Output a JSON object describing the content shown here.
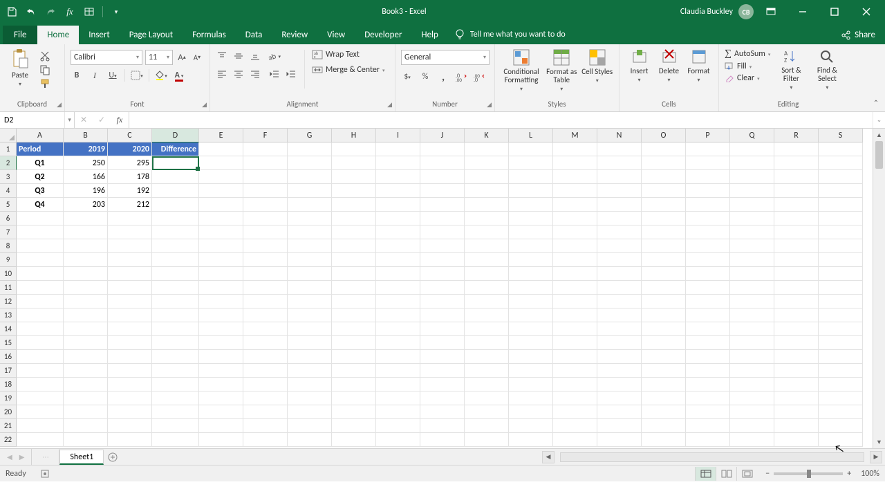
{
  "title": "Book3  -  Excel",
  "user": {
    "name": "Claudia Buckley",
    "initials": "CB"
  },
  "tabs": [
    "File",
    "Home",
    "Insert",
    "Page Layout",
    "Formulas",
    "Data",
    "Review",
    "View",
    "Developer",
    "Help"
  ],
  "active_tab": "Home",
  "tell_me": "Tell me what you want to do",
  "share": "Share",
  "ribbon": {
    "clipboard": {
      "label": "Clipboard",
      "paste": "Paste"
    },
    "font": {
      "label": "Font",
      "name": "Calibri",
      "size": "11"
    },
    "alignment": {
      "label": "Alignment",
      "wrap": "Wrap Text",
      "merge": "Merge & Center"
    },
    "number": {
      "label": "Number",
      "format": "General"
    },
    "styles": {
      "label": "Styles",
      "cond": "Conditional Formatting",
      "table": "Format as Table",
      "cell": "Cell Styles"
    },
    "cells": {
      "label": "Cells",
      "insert": "Insert",
      "delete": "Delete",
      "format": "Format"
    },
    "editing": {
      "label": "Editing",
      "autosum": "AutoSum",
      "fill": "Fill",
      "clear": "Clear",
      "sort": "Sort & Filter",
      "find": "Find & Select"
    }
  },
  "name_box": "D2",
  "formula": "",
  "columns": [
    "A",
    "B",
    "C",
    "D",
    "E",
    "F",
    "G",
    "H",
    "I",
    "J",
    "K",
    "L",
    "M",
    "N",
    "O",
    "P",
    "Q",
    "R",
    "S"
  ],
  "rows": 22,
  "chart_data": {
    "type": "table",
    "headers": [
      "Period",
      "2019",
      "2020",
      "Difference"
    ],
    "rows": [
      [
        "Q1",
        250,
        295,
        null
      ],
      [
        "Q2",
        166,
        178,
        null
      ],
      [
        "Q3",
        196,
        192,
        null
      ],
      [
        "Q4",
        203,
        212,
        null
      ]
    ]
  },
  "selection": {
    "cell": "D2",
    "col": 3,
    "row": 1
  },
  "sheet": {
    "active": "Sheet1"
  },
  "status": {
    "mode": "Ready",
    "zoom": "100%"
  }
}
